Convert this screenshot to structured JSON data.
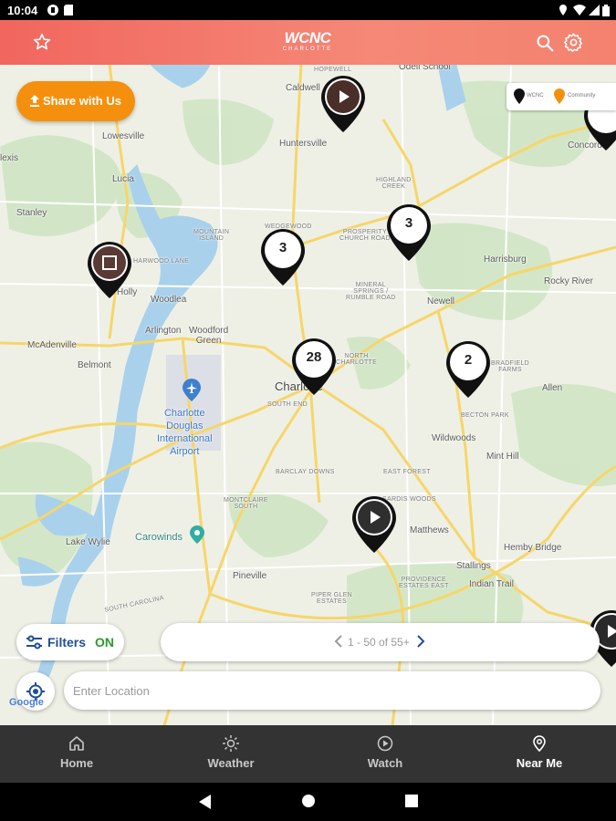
{
  "status_bar": {
    "time": "10:04"
  },
  "header": {
    "logo_brand": "WCNC",
    "logo_sub": "CHARLOTTE"
  },
  "map": {
    "places": {
      "hopewell": "HOPEWELL",
      "caldwell": "Caldwell",
      "odell_school": "Odell School",
      "concord": "Concord",
      "huntersville": "Huntersville",
      "lowesville": "Lowesville",
      "lucia": "Lucia",
      "lexis": "lexis",
      "highland_creek": "HIGHLAND\nCREEK",
      "stanley": "Stanley",
      "mountain_island": "MOUNTAIN\nISLAND",
      "wedgewood": "WEDGEWOOD",
      "prosperity": "PROSPERITY\nCHURCH ROAD",
      "harrisburg": "Harrisburg",
      "harwood_lane": "HARWOOD LANE",
      "holly": "Holly",
      "woodlea": "Woodlea",
      "rocky_river": "Rocky River",
      "mineral_springs": "MINERAL\nSPRINGS /\nRUMBLE ROAD",
      "newell": "Newell",
      "arlington": "Arlington",
      "woodford_green": "Woodford\nGreen",
      "mcadenville": "McAdenville",
      "north_charlotte": "NORTH\nCHARLOTTE",
      "belmont": "Belmont",
      "bradfield_farms": "BRADFIELD\nFARMS",
      "charlotte": "Charlotte",
      "allen": "Allen",
      "south_end": "SOUTH END",
      "airport": "Charlotte\nDouglas\nInternational\nAirport",
      "becton_park": "BECTON PARK",
      "wildwoods": "Wildwoods",
      "mint_hill": "Mint Hill",
      "east_forest": "EAST FOREST",
      "barclay_downs": "BARCLAY DOWNS",
      "montclaire_south": "MONTCLAIRE\nSOUTH",
      "sardis_woods": "SARDIS WOODS",
      "matthews": "Matthews",
      "carowinds": "Carowinds",
      "lake_wylie": "Lake Wylie",
      "hemby_bridge": "Hemby Bridge",
      "stallings": "Stallings",
      "providence": "PROVIDENCE\nESTATES EAST",
      "indian_trail": "Indian Trail",
      "pineville": "Pineville",
      "piper_glen": "PIPER GLEN\nESTATES",
      "south_carolina": "SOUTH CAROLINA",
      "google": "Google"
    },
    "pins": [
      {
        "name": "video-pin-huntersville",
        "kind": "video"
      },
      {
        "name": "cluster-pin-3-northwest",
        "kind": "count",
        "count": "3"
      },
      {
        "name": "cluster-pin-3-northeast",
        "kind": "count",
        "count": "3"
      },
      {
        "name": "cluster-pin-28-charlotte",
        "kind": "count",
        "count": "28"
      },
      {
        "name": "cluster-pin-2-east",
        "kind": "count",
        "count": "2"
      },
      {
        "name": "photo-pin-holly",
        "kind": "photo"
      },
      {
        "name": "video-pin-matthews",
        "kind": "video"
      }
    ],
    "legend": {
      "wcnc": "WCNC",
      "community": "Community"
    },
    "share_button": "Share with Us",
    "filters": {
      "label": "Filters",
      "state": "ON"
    },
    "pager": {
      "text": "1 - 50 of 55+"
    },
    "location_input": {
      "placeholder": "Enter Location",
      "value": ""
    }
  },
  "bottom_nav": {
    "items": [
      {
        "label": "Home",
        "icon": "home-icon"
      },
      {
        "label": "Weather",
        "icon": "sun-icon"
      },
      {
        "label": "Watch",
        "icon": "play-circle-icon"
      },
      {
        "label": "Near Me",
        "icon": "location-pin-icon",
        "active": true
      }
    ]
  },
  "colors": {
    "header": "#f1665e",
    "share": "#f5900e",
    "filters_on": "#2a9a2a",
    "nav": "#333333"
  }
}
